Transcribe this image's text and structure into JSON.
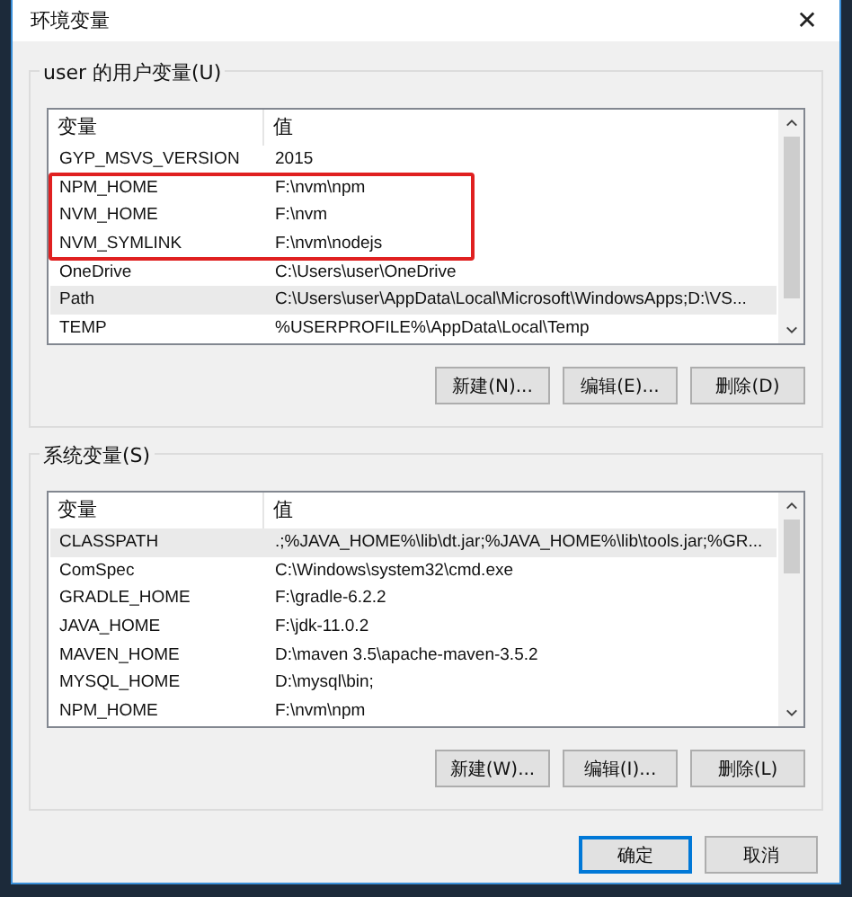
{
  "window": {
    "title": "环境变量",
    "close": "✕"
  },
  "user_vars": {
    "label": "user 的用户变量(U)",
    "columns": [
      "变量",
      "值"
    ],
    "rows": [
      {
        "name": "GYP_MSVS_VERSION",
        "value": "2015",
        "selected": false,
        "boxed": false
      },
      {
        "name": "NPM_HOME",
        "value": "F:\\nvm\\npm",
        "selected": false,
        "boxed": true
      },
      {
        "name": "NVM_HOME",
        "value": "F:\\nvm",
        "selected": false,
        "boxed": true
      },
      {
        "name": "NVM_SYMLINK",
        "value": "F:\\nvm\\nodejs",
        "selected": false,
        "boxed": true
      },
      {
        "name": "OneDrive",
        "value": "C:\\Users\\user\\OneDrive",
        "selected": false,
        "boxed": false
      },
      {
        "name": "Path",
        "value": "C:\\Users\\user\\AppData\\Local\\Microsoft\\WindowsApps;D:\\VS...",
        "selected": true,
        "boxed": false
      },
      {
        "name": "TEMP",
        "value": "%USERPROFILE%\\AppData\\Local\\Temp",
        "selected": false,
        "boxed": false
      }
    ],
    "buttons": [
      "新建(N)...",
      "编辑(E)...",
      "删除(D)"
    ]
  },
  "system_vars": {
    "label": "系统变量(S)",
    "columns": [
      "变量",
      "值"
    ],
    "rows": [
      {
        "name": "CLASSPATH",
        "value": ".;%JAVA_HOME%\\lib\\dt.jar;%JAVA_HOME%\\lib\\tools.jar;%GR...",
        "selected": true,
        "boxed": false
      },
      {
        "name": "ComSpec",
        "value": "C:\\Windows\\system32\\cmd.exe",
        "selected": false,
        "boxed": false
      },
      {
        "name": "GRADLE_HOME",
        "value": "F:\\gradle-6.2.2",
        "selected": false,
        "boxed": false
      },
      {
        "name": "JAVA_HOME",
        "value": "F:\\jdk-11.0.2",
        "selected": false,
        "boxed": false
      },
      {
        "name": "MAVEN_HOME",
        "value": "D:\\maven 3.5\\apache-maven-3.5.2",
        "selected": false,
        "boxed": false
      },
      {
        "name": "MYSQL_HOME",
        "value": "D:\\mysql\\bin;",
        "selected": false,
        "boxed": false
      },
      {
        "name": "NPM_HOME",
        "value": "F:\\nvm\\npm",
        "selected": false,
        "boxed": false
      }
    ],
    "buttons": [
      "新建(W)...",
      "编辑(I)...",
      "删除(L)"
    ]
  },
  "footer_buttons": [
    {
      "label": "确定",
      "default": true
    },
    {
      "label": "取消",
      "default": false
    }
  ]
}
